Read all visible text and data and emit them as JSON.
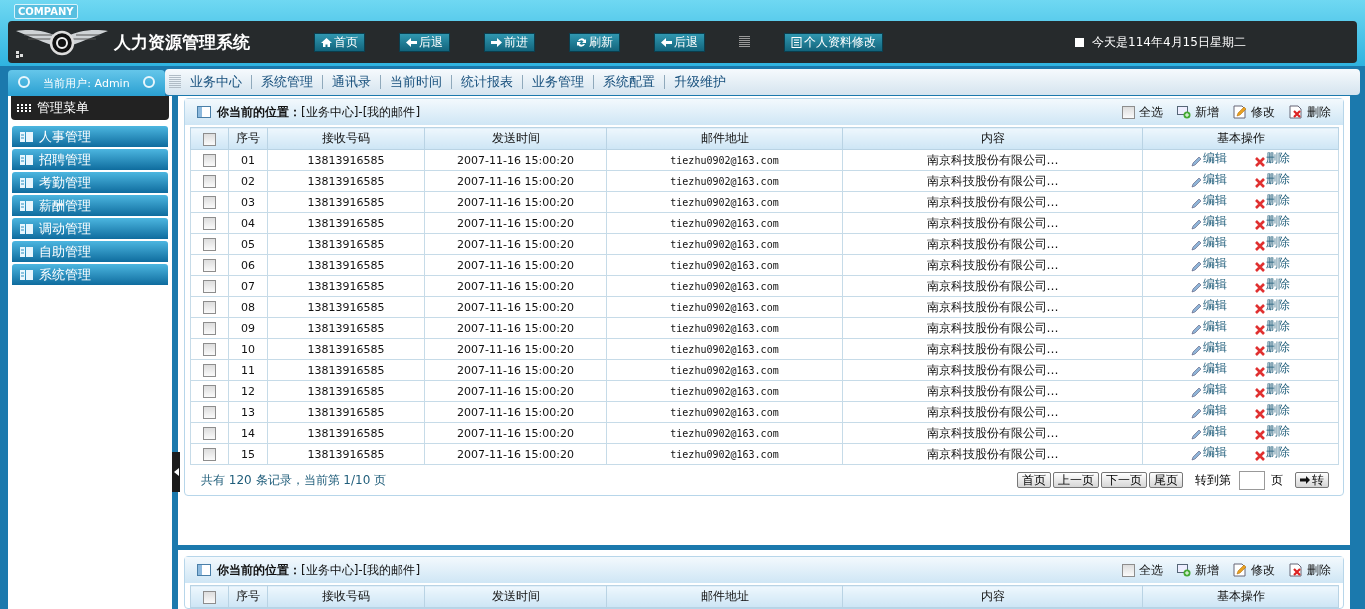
{
  "header": {
    "badge": "COMPANY",
    "title": "人力资源管理系统",
    "nav": [
      {
        "kind": "home",
        "label": "首页"
      },
      {
        "kind": "back",
        "label": "后退"
      },
      {
        "kind": "forward",
        "label": "前进"
      },
      {
        "kind": "refresh",
        "label": "刷新"
      },
      {
        "kind": "back",
        "label": "后退"
      },
      {
        "kind": "grip"
      },
      {
        "kind": "doc",
        "label": "个人资料修改"
      }
    ],
    "date": "今天是114年4月15日星期二"
  },
  "user": "当前用户: Admin",
  "menu": [
    "业务中心",
    "系统管理",
    "通讯录",
    "当前时间",
    "统计报表",
    "业务管理",
    "系统配置",
    "升级维护"
  ],
  "sidebar": {
    "title": "管理菜单",
    "items": [
      "人事管理",
      "招聘管理",
      "考勤管理",
      "薪酬管理",
      "调动管理",
      "自助管理",
      "系统管理"
    ]
  },
  "panels": [
    {
      "location": "**你当前的位置：**[业务中心]-[我的邮件]",
      "select_all": {
        "label": "全选",
        "checked": false
      },
      "actions": [
        "新增",
        "修改",
        "删除"
      ],
      "header_checked": false,
      "columns": [
        "序号",
        "接收号码",
        "发送时间",
        "邮件地址",
        "内容",
        "基本操作"
      ],
      "rows": [
        {
          "checked": false,
          "cells": [
            "01",
            "13813916585",
            "2007-11-16 15:00:20",
            "tiezhu0902@163.com",
            "南京科技股份有限公司…"
          ],
          "actions": [
            "编辑",
            "删除"
          ]
        },
        {
          "checked": false,
          "cells": [
            "02",
            "13813916585",
            "2007-11-16 15:00:20",
            "tiezhu0902@163.com",
            "南京科技股份有限公司…"
          ],
          "actions": [
            "编辑",
            "删除"
          ]
        },
        {
          "checked": false,
          "cells": [
            "03",
            "13813916585",
            "2007-11-16 15:00:20",
            "tiezhu0902@163.com",
            "南京科技股份有限公司…"
          ],
          "actions": [
            "编辑",
            "删除"
          ]
        },
        {
          "checked": false,
          "cells": [
            "04",
            "13813916585",
            "2007-11-16 15:00:20",
            "tiezhu0902@163.com",
            "南京科技股份有限公司…"
          ],
          "actions": [
            "编辑",
            "删除"
          ]
        },
        {
          "checked": false,
          "cells": [
            "05",
            "13813916585",
            "2007-11-16 15:00:20",
            "tiezhu0902@163.com",
            "南京科技股份有限公司…"
          ],
          "actions": [
            "编辑",
            "删除"
          ]
        },
        {
          "checked": false,
          "cells": [
            "06",
            "13813916585",
            "2007-11-16 15:00:20",
            "tiezhu0902@163.com",
            "南京科技股份有限公司…"
          ],
          "actions": [
            "编辑",
            "删除"
          ]
        },
        {
          "checked": false,
          "cells": [
            "07",
            "13813916585",
            "2007-11-16 15:00:20",
            "tiezhu0902@163.com",
            "南京科技股份有限公司…"
          ],
          "actions": [
            "编辑",
            "删除"
          ]
        },
        {
          "checked": false,
          "cells": [
            "08",
            "13813916585",
            "2007-11-16 15:00:20",
            "tiezhu0902@163.com",
            "南京科技股份有限公司…"
          ],
          "actions": [
            "编辑",
            "删除"
          ]
        },
        {
          "checked": false,
          "cells": [
            "09",
            "13813916585",
            "2007-11-16 15:00:20",
            "tiezhu0902@163.com",
            "南京科技股份有限公司…"
          ],
          "actions": [
            "编辑",
            "删除"
          ]
        },
        {
          "checked": false,
          "cells": [
            "10",
            "13813916585",
            "2007-11-16 15:00:20",
            "tiezhu0902@163.com",
            "南京科技股份有限公司…"
          ],
          "actions": [
            "编辑",
            "删除"
          ]
        },
        {
          "checked": false,
          "cells": [
            "11",
            "13813916585",
            "2007-11-16 15:00:20",
            "tiezhu0902@163.com",
            "南京科技股份有限公司…"
          ],
          "actions": [
            "编辑",
            "删除"
          ]
        },
        {
          "checked": false,
          "cells": [
            "12",
            "13813916585",
            "2007-11-16 15:00:20",
            "tiezhu0902@163.com",
            "南京科技股份有限公司…"
          ],
          "actions": [
            "编辑",
            "删除"
          ]
        },
        {
          "checked": false,
          "cells": [
            "13",
            "13813916585",
            "2007-11-16 15:00:20",
            "tiezhu0902@163.com",
            "南京科技股份有限公司…"
          ],
          "actions": [
            "编辑",
            "删除"
          ]
        },
        {
          "checked": false,
          "cells": [
            "14",
            "13813916585",
            "2007-11-16 15:00:20",
            "tiezhu0902@163.com",
            "南京科技股份有限公司…"
          ],
          "actions": [
            "编辑",
            "删除"
          ]
        },
        {
          "checked": false,
          "cells": [
            "15",
            "13813916585",
            "2007-11-16 15:00:20",
            "tiezhu0902@163.com",
            "南京科技股份有限公司…"
          ],
          "actions": [
            "编辑",
            "删除"
          ]
        }
      ],
      "pager": {
        "summary": "共有 120 条记录，当前第 1/10 页",
        "buttons": [
          "首页",
          "上一页",
          "下一页",
          "尾页"
        ],
        "goto_label": "转到第",
        "goto_suffix": "页",
        "go": "转"
      }
    },
    {
      "location": "**你当前的位置：**[业务中心]-[我的邮件]",
      "select_all": {
        "label": "全选",
        "checked": false
      },
      "actions": [
        "新增",
        "修改",
        "删除"
      ],
      "header_checked": false,
      "columns": [
        "序号",
        "接收号码",
        "发送时间",
        "邮件地址",
        "内容",
        "基本操作"
      ]
    }
  ]
}
